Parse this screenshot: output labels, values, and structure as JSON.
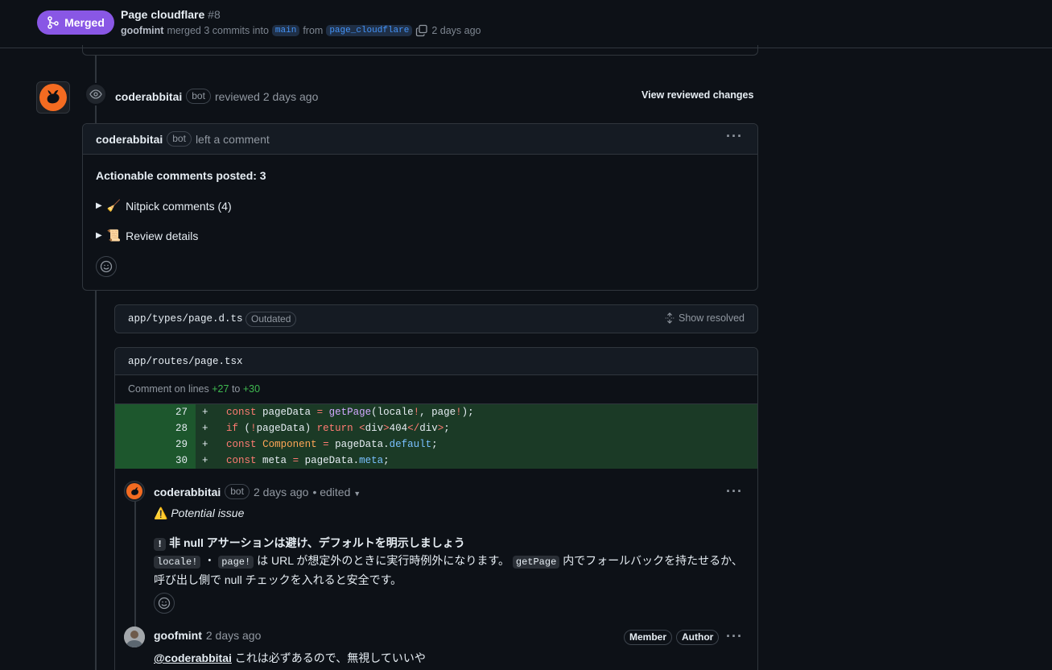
{
  "pr": {
    "status": "Merged",
    "title": "Page cloudflare",
    "number": "#8",
    "author": "goofmint",
    "merge_text": "merged 3 commits into",
    "base_branch": "main",
    "from_text": "from",
    "head_branch": "page_cloudflare",
    "time": "2 days ago"
  },
  "review": {
    "user": "coderabbitai",
    "bot_label": "bot",
    "action": "reviewed 2 days ago",
    "view_changes": "View reviewed changes",
    "box_user": "coderabbitai",
    "box_action": "left a comment",
    "actionable": "Actionable comments posted: 3",
    "nitpick": "Nitpick comments (4)",
    "nitpick_emoji": "🧹",
    "review_details": "Review details",
    "review_details_emoji": "📜"
  },
  "files": {
    "outdated_name": "app/types/page.d.ts",
    "outdated_badge": "Outdated",
    "show_resolved": "Show resolved",
    "current_name": "app/routes/page.tsx",
    "comment_on_lines": "Comment on lines",
    "line_from": "+27",
    "line_to_word": "to",
    "line_to": "+30"
  },
  "diff": [
    {
      "num": "27",
      "sign": "+"
    },
    {
      "num": "28",
      "sign": "+"
    },
    {
      "num": "29",
      "sign": "+"
    },
    {
      "num": "30",
      "sign": "+"
    }
  ],
  "comment1": {
    "user": "coderabbitai",
    "bot_label": "bot",
    "time": "2 days ago",
    "edited": "• edited",
    "warning_emoji": "⚠️",
    "potential_issue": "Potential issue",
    "heading_code": "!",
    "heading": "非 null アサーションは避け、デフォルトを明示しましょう",
    "code1": "locale!",
    "sep": "・",
    "code2": "page!",
    "text1": "は URL が想定外のときに実行時例外になります。",
    "code3": "getPage",
    "text2": "内でフォールバックを持たせるか、",
    "text3": "呼び出し側で null チェックを入れると安全です。"
  },
  "comment2": {
    "user": "goofmint",
    "time": "2 days ago",
    "badge_member": "Member",
    "badge_author": "Author",
    "mention": "@coderabbitai",
    "text": "これは必ずあるので、無視していいや"
  },
  "colors": {
    "merged": "#8957e5",
    "rabbit": "#f36b21",
    "diff_add": "#1b3a26"
  }
}
